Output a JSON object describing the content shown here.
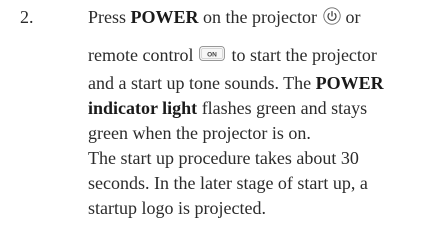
{
  "step": {
    "number": "2.",
    "line1": {
      "pre": "Press ",
      "bold": "POWER",
      "post": " on the projector",
      "icon": "power-icon",
      "trail": " or"
    },
    "line2": {
      "pre": "remote control",
      "button_icon": "remote-on-button-icon",
      "button_label": "ON",
      "post": "to start the projector"
    },
    "line3": {
      "pre": "and a start up tone sounds. The ",
      "bold": "POWER"
    },
    "line4": {
      "bold": "indicator light",
      "post": " flashes green and stays"
    },
    "line5": "green when the projector is on.",
    "line6": "The start up procedure takes about 30",
    "line7": "seconds. In the later stage of start up, a",
    "line8": "startup logo is projected."
  }
}
